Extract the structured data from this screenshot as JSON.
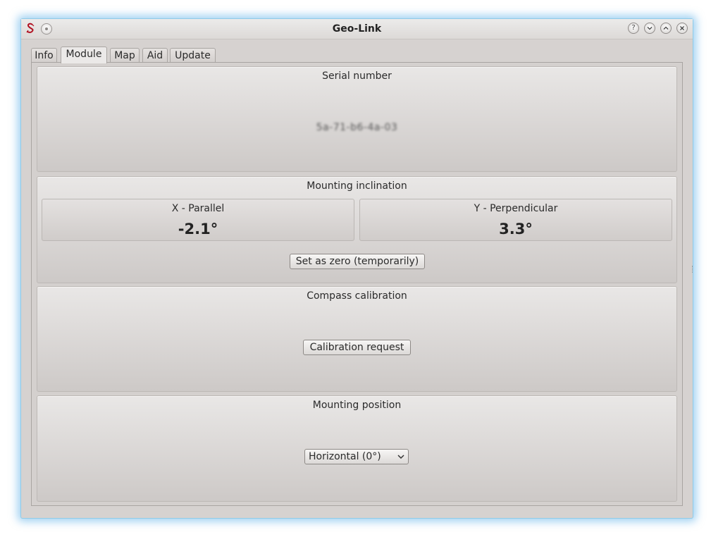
{
  "window": {
    "title": "Geo-Link",
    "accent_color": "#8fcbe8",
    "controls": [
      "help-icon",
      "minimize-icon",
      "maximize-icon",
      "close-icon"
    ]
  },
  "tabs": [
    {
      "label": "Info"
    },
    {
      "label": "Module"
    },
    {
      "label": "Map"
    },
    {
      "label": "Aid"
    },
    {
      "label": "Update"
    }
  ],
  "active_tab": "Module",
  "serial": {
    "title": "Serial number",
    "value": "5a-71-b6-4a-03"
  },
  "inclination": {
    "title": "Mounting inclination",
    "x_label": "X - Parallel",
    "x_value": "-2.1°",
    "y_label": "Y - Perpendicular",
    "y_value": "3.3°",
    "zero_button": "Set as zero (temporarily)"
  },
  "compass": {
    "title": "Compass calibration",
    "button": "Calibration request"
  },
  "position": {
    "title": "Mounting position",
    "selected": "Horizontal (0°)"
  }
}
